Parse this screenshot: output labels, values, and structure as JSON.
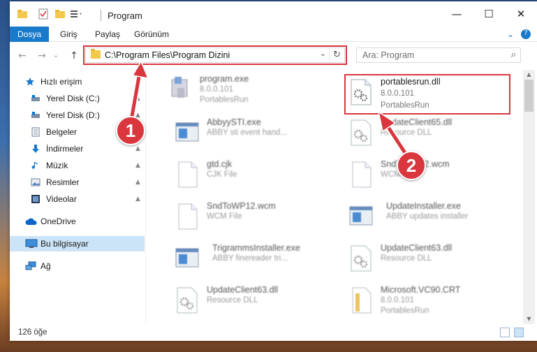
{
  "window": {
    "title": "Program",
    "minimize": "—",
    "maximize": "☐",
    "close": "✕"
  },
  "ribbon": {
    "tabs": [
      "Dosya",
      "Giriş",
      "Paylaş",
      "Görünüm"
    ],
    "expand": "⌄",
    "help": "?"
  },
  "nav": {
    "back": "←",
    "forward": "→",
    "recent": "⌄",
    "up": "↑",
    "address": "C:\\Program Files\\Program Dizini",
    "address_dropdown": "⌄",
    "refresh": "↻",
    "search_placeholder": "Ara: Program",
    "search_icon": "⌕"
  },
  "sidebar": {
    "items": [
      {
        "label": "Hızlı erişim",
        "icon": "star-icon",
        "pinned": false
      },
      {
        "label": "Yerel Disk (C:)",
        "icon": "drive-icon",
        "pinned": true
      },
      {
        "label": "Yerel Disk (D:)",
        "icon": "drive-icon",
        "pinned": true
      },
      {
        "label": "Belgeler",
        "icon": "documents-icon",
        "pinned": true
      },
      {
        "label": "İndirmeler",
        "icon": "download-icon",
        "pinned": true
      },
      {
        "label": "Müzik",
        "icon": "music-icon",
        "pinned": true
      },
      {
        "label": "Resimler",
        "icon": "pictures-icon",
        "pinned": true
      },
      {
        "label": "Videolar",
        "icon": "videos-icon",
        "pinned": true
      },
      {
        "label": "OneDrive",
        "icon": "cloud-icon",
        "pinned": false
      },
      {
        "label": "Bu bilgisayar",
        "icon": "computer-icon",
        "pinned": false,
        "selected": true
      },
      {
        "label": "Ağ",
        "icon": "network-icon",
        "pinned": false
      }
    ],
    "pin_glyph": "📌"
  },
  "files": [
    {
      "name": "program.exe",
      "line2": "8.0.0.101",
      "line3": "PortablesRun",
      "icon": "exe-icon"
    },
    {
      "name": "portablesrun.dll",
      "line2": "8.0.0.101",
      "line3": "PortablesRun",
      "icon": "dll-gear-icon",
      "highlighted": true
    },
    {
      "name": "AbbyySTI.exe",
      "line2": "ABBY sti event hand...",
      "icon": "window-exe-icon"
    },
    {
      "name": "UpdateClient65.dll",
      "line2": "Resource DLL",
      "icon": "dll-gear-icon"
    },
    {
      "name": "gtd.cjk",
      "line2": "CJK File",
      "icon": "blank-file-icon"
    },
    {
      "name": "SndToWP12.wcm",
      "line2": "WCM File",
      "icon": "blank-file-icon"
    },
    {
      "name": "SndToWP12.wcm",
      "line2": "WCM File",
      "icon": "blank-file-icon"
    },
    {
      "name": "UpdateInstaller.exe",
      "line2": "ABBY updates installer",
      "icon": "window-exe-icon"
    },
    {
      "name": "TrigrammsInstaller.exe",
      "line2": "ABBY finereader tri...",
      "icon": "window-exe-icon"
    },
    {
      "name": "UpdateClient63.dll",
      "line2": "Resource DLL",
      "icon": "dll-gear-icon"
    },
    {
      "name": "UpdateClient63.dll",
      "line2": "Resource DLL",
      "icon": "dll-gear-icon"
    },
    {
      "name": "Microsoft.VC90.CRT",
      "line2": "8.0.0.101",
      "line3": "PortablesRun",
      "icon": "folder-zip-icon"
    }
  ],
  "status": {
    "count": "126 öğe"
  },
  "callouts": [
    "1",
    "2"
  ],
  "colors": {
    "accent": "#1979ca",
    "highlight": "#d9363e",
    "selection": "#cce4f7"
  }
}
